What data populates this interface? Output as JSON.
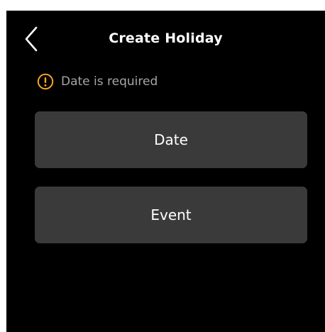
{
  "header": {
    "title": "Create Holiday",
    "back_icon": "chevron-left-icon"
  },
  "validation": {
    "icon": "warning-circle-icon",
    "message": "Date is required",
    "color": "#f5a623"
  },
  "form": {
    "date_label": "Date",
    "event_label": "Event"
  },
  "colors": {
    "background": "#000000",
    "field_background": "#3a3a3a",
    "text": "#ffffff",
    "muted_text": "#a6a6a6"
  }
}
